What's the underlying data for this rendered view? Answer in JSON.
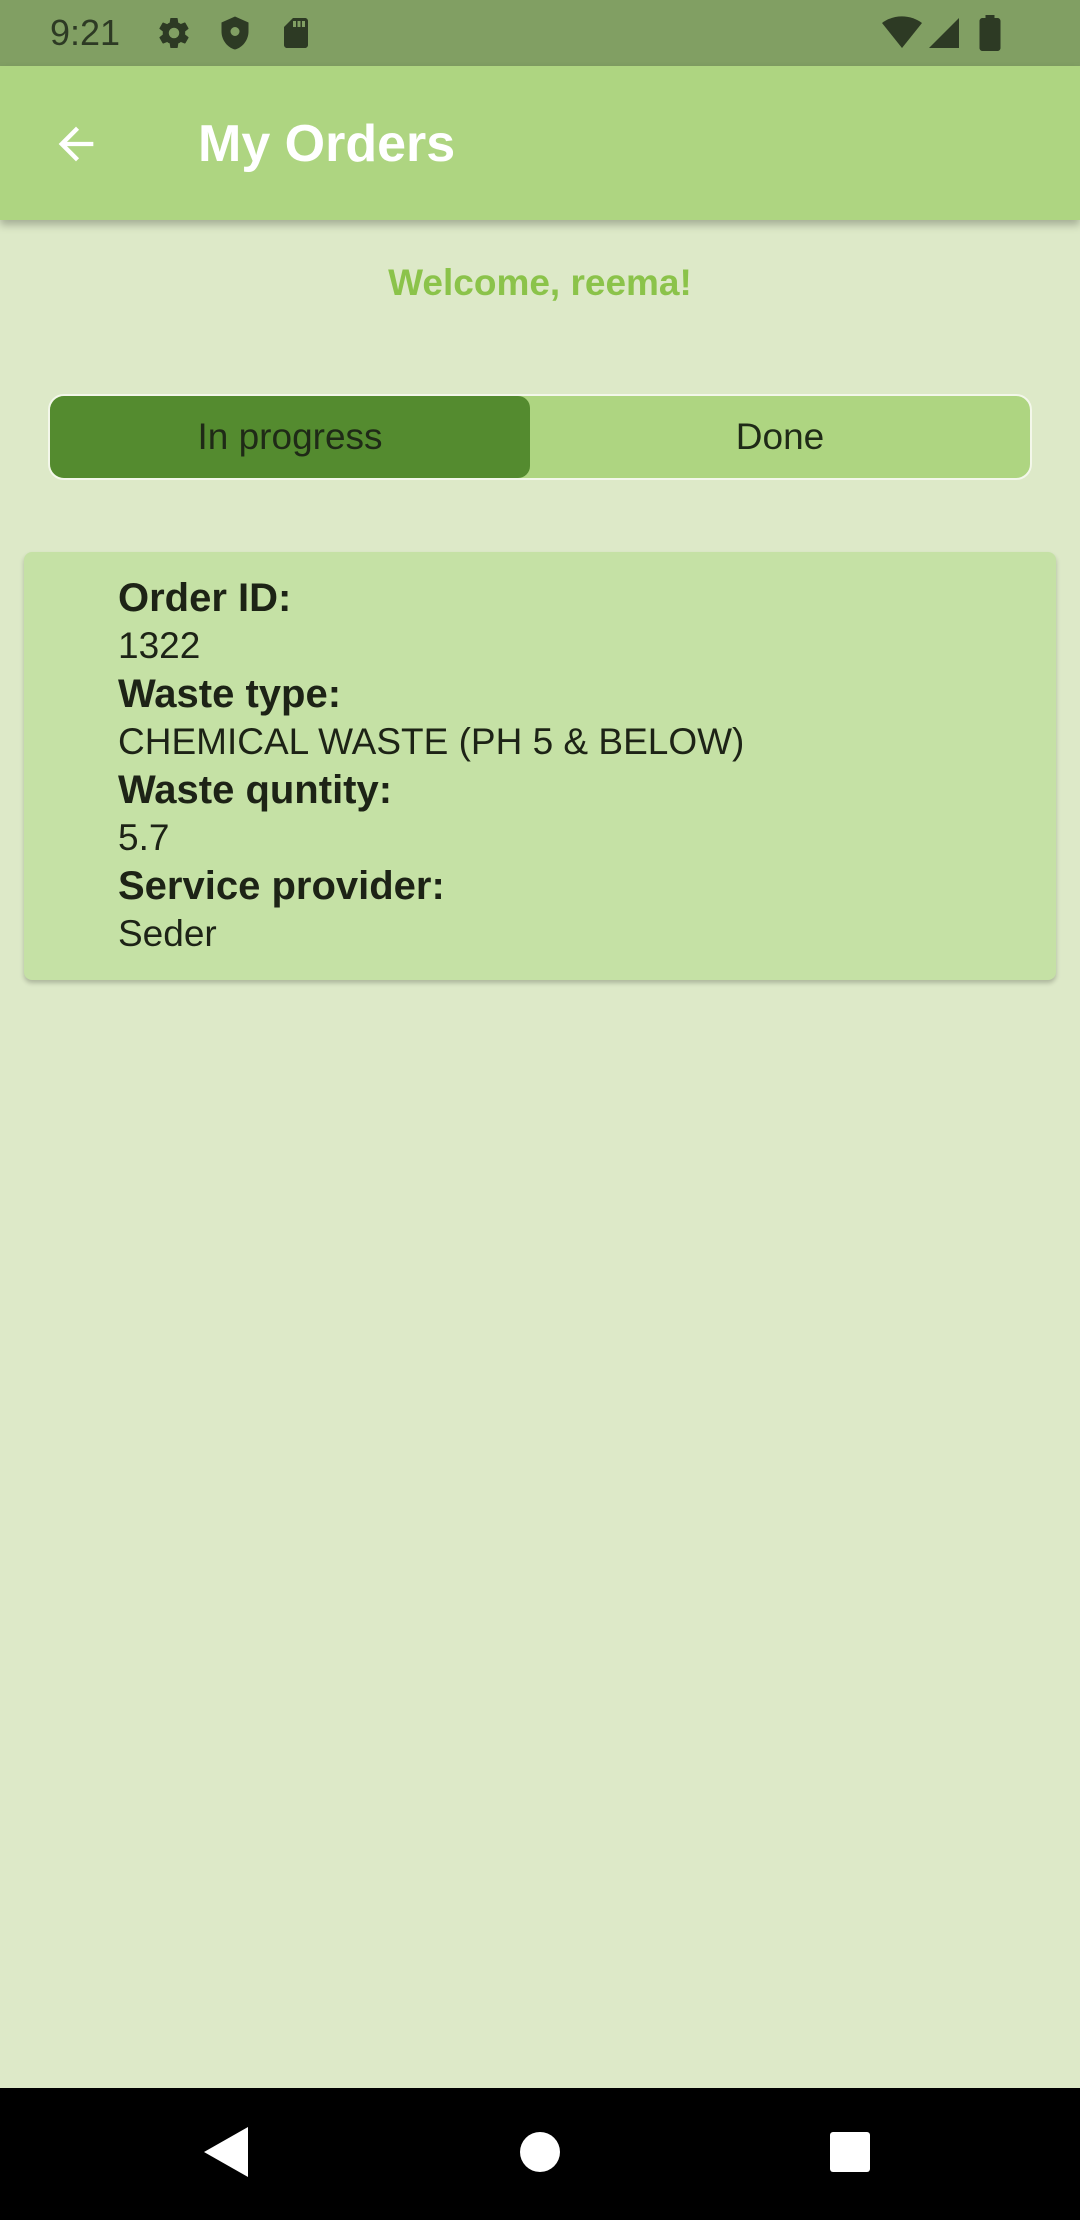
{
  "status_bar": {
    "time": "9:21",
    "left_icons": [
      "gear-icon",
      "shield-icon",
      "sd-card-icon"
    ],
    "right_icons": [
      "wifi-icon",
      "signal-icon",
      "battery-icon"
    ]
  },
  "app_bar": {
    "title": "My Orders",
    "back_icon": "arrow-back-icon"
  },
  "welcome_text": "Welcome, reema!",
  "tabs": [
    {
      "label": "In progress",
      "selected": true
    },
    {
      "label": "Done",
      "selected": false
    }
  ],
  "order": {
    "order_id_label": "Order ID:",
    "order_id": "1322",
    "waste_type_label": "Waste type:",
    "waste_type": "CHEMICAL WASTE (PH 5 & BELOW)",
    "waste_quantity_label": "Waste quntity:",
    "waste_quantity": "5.7",
    "service_provider_label": "Service provider:",
    "service_provider": "Seder"
  },
  "nav_bar": {
    "icons": [
      "back-triangle-icon",
      "home-circle-icon",
      "recents-square-icon"
    ]
  },
  "colors": {
    "status_bar": "#819f63",
    "app_bar": "#aed581",
    "background": "#dde9c8",
    "welcome": "#8bc34a",
    "tab_selected": "#548b2f",
    "tab_unselected": "#aed581",
    "card": "#c5e1a5"
  }
}
